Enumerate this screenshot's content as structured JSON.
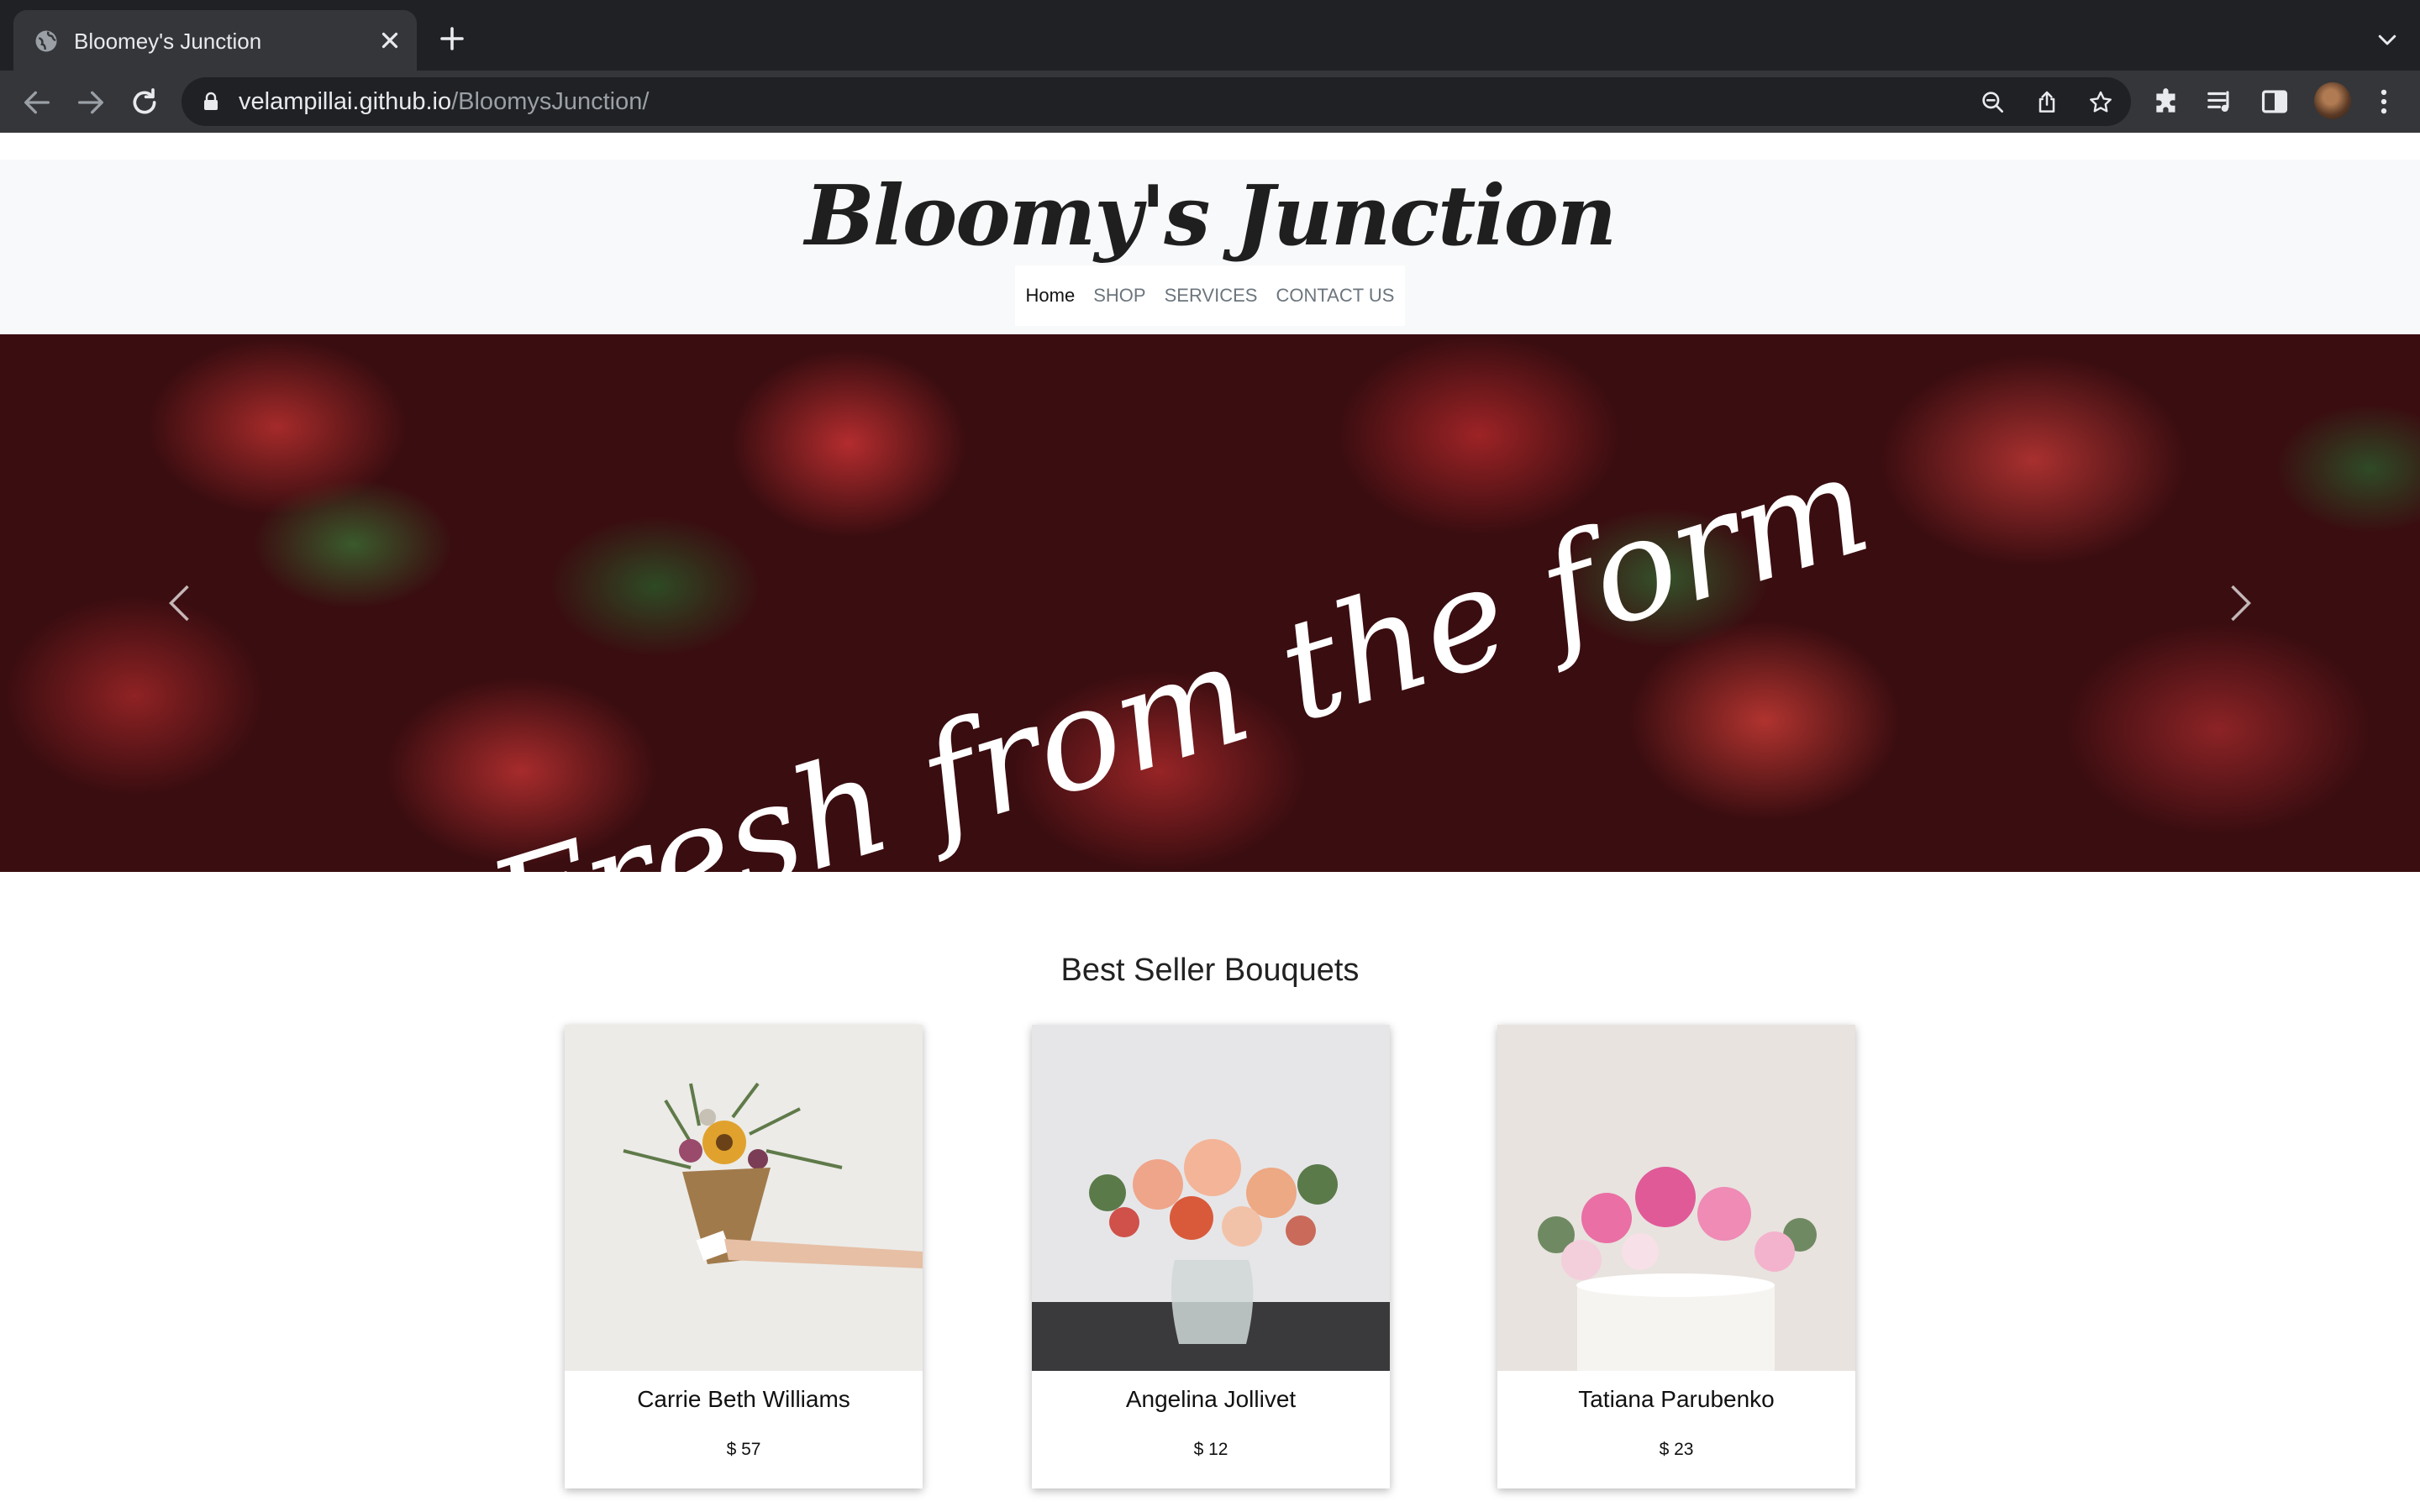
{
  "browser": {
    "tab_title": "Bloomey's Junction",
    "url_host": "velampillai.github.io",
    "url_path": "/BloomysJunction/"
  },
  "site": {
    "logo": "Bloomy's Junction",
    "nav": [
      "Home",
      "SHOP",
      "SERVICES",
      "CONTACT US"
    ],
    "active_nav": "Home"
  },
  "hero": {
    "caption": "Fresh from the form"
  },
  "bestsellers": {
    "title": "Best Seller Bouquets",
    "items": [
      {
        "name": "Carrie Beth Williams",
        "price": "$ 57"
      },
      {
        "name": "Angelina Jollivet",
        "price": "$ 12"
      },
      {
        "name": "Tatiana Parubenko",
        "price": "$ 23"
      }
    ]
  },
  "colors": {
    "chrome_dark": "#202124",
    "chrome_tab": "#35363a",
    "header_bg": "#f8f9fa",
    "nav_muted": "#6c757d"
  }
}
